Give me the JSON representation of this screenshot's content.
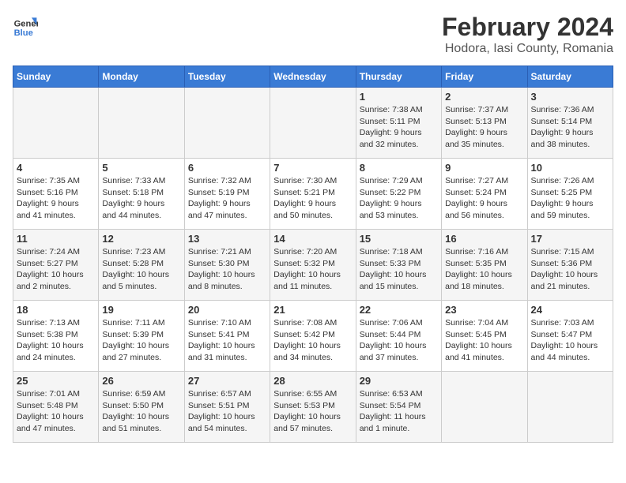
{
  "header": {
    "logo_general": "General",
    "logo_blue": "Blue",
    "main_title": "February 2024",
    "subtitle": "Hodora, Iasi County, Romania"
  },
  "columns": [
    "Sunday",
    "Monday",
    "Tuesday",
    "Wednesday",
    "Thursday",
    "Friday",
    "Saturday"
  ],
  "weeks": [
    [
      {
        "day": "",
        "info": ""
      },
      {
        "day": "",
        "info": ""
      },
      {
        "day": "",
        "info": ""
      },
      {
        "day": "",
        "info": ""
      },
      {
        "day": "1",
        "info": "Sunrise: 7:38 AM\nSunset: 5:11 PM\nDaylight: 9 hours\nand 32 minutes."
      },
      {
        "day": "2",
        "info": "Sunrise: 7:37 AM\nSunset: 5:13 PM\nDaylight: 9 hours\nand 35 minutes."
      },
      {
        "day": "3",
        "info": "Sunrise: 7:36 AM\nSunset: 5:14 PM\nDaylight: 9 hours\nand 38 minutes."
      }
    ],
    [
      {
        "day": "4",
        "info": "Sunrise: 7:35 AM\nSunset: 5:16 PM\nDaylight: 9 hours\nand 41 minutes."
      },
      {
        "day": "5",
        "info": "Sunrise: 7:33 AM\nSunset: 5:18 PM\nDaylight: 9 hours\nand 44 minutes."
      },
      {
        "day": "6",
        "info": "Sunrise: 7:32 AM\nSunset: 5:19 PM\nDaylight: 9 hours\nand 47 minutes."
      },
      {
        "day": "7",
        "info": "Sunrise: 7:30 AM\nSunset: 5:21 PM\nDaylight: 9 hours\nand 50 minutes."
      },
      {
        "day": "8",
        "info": "Sunrise: 7:29 AM\nSunset: 5:22 PM\nDaylight: 9 hours\nand 53 minutes."
      },
      {
        "day": "9",
        "info": "Sunrise: 7:27 AM\nSunset: 5:24 PM\nDaylight: 9 hours\nand 56 minutes."
      },
      {
        "day": "10",
        "info": "Sunrise: 7:26 AM\nSunset: 5:25 PM\nDaylight: 9 hours\nand 59 minutes."
      }
    ],
    [
      {
        "day": "11",
        "info": "Sunrise: 7:24 AM\nSunset: 5:27 PM\nDaylight: 10 hours\nand 2 minutes."
      },
      {
        "day": "12",
        "info": "Sunrise: 7:23 AM\nSunset: 5:28 PM\nDaylight: 10 hours\nand 5 minutes."
      },
      {
        "day": "13",
        "info": "Sunrise: 7:21 AM\nSunset: 5:30 PM\nDaylight: 10 hours\nand 8 minutes."
      },
      {
        "day": "14",
        "info": "Sunrise: 7:20 AM\nSunset: 5:32 PM\nDaylight: 10 hours\nand 11 minutes."
      },
      {
        "day": "15",
        "info": "Sunrise: 7:18 AM\nSunset: 5:33 PM\nDaylight: 10 hours\nand 15 minutes."
      },
      {
        "day": "16",
        "info": "Sunrise: 7:16 AM\nSunset: 5:35 PM\nDaylight: 10 hours\nand 18 minutes."
      },
      {
        "day": "17",
        "info": "Sunrise: 7:15 AM\nSunset: 5:36 PM\nDaylight: 10 hours\nand 21 minutes."
      }
    ],
    [
      {
        "day": "18",
        "info": "Sunrise: 7:13 AM\nSunset: 5:38 PM\nDaylight: 10 hours\nand 24 minutes."
      },
      {
        "day": "19",
        "info": "Sunrise: 7:11 AM\nSunset: 5:39 PM\nDaylight: 10 hours\nand 27 minutes."
      },
      {
        "day": "20",
        "info": "Sunrise: 7:10 AM\nSunset: 5:41 PM\nDaylight: 10 hours\nand 31 minutes."
      },
      {
        "day": "21",
        "info": "Sunrise: 7:08 AM\nSunset: 5:42 PM\nDaylight: 10 hours\nand 34 minutes."
      },
      {
        "day": "22",
        "info": "Sunrise: 7:06 AM\nSunset: 5:44 PM\nDaylight: 10 hours\nand 37 minutes."
      },
      {
        "day": "23",
        "info": "Sunrise: 7:04 AM\nSunset: 5:45 PM\nDaylight: 10 hours\nand 41 minutes."
      },
      {
        "day": "24",
        "info": "Sunrise: 7:03 AM\nSunset: 5:47 PM\nDaylight: 10 hours\nand 44 minutes."
      }
    ],
    [
      {
        "day": "25",
        "info": "Sunrise: 7:01 AM\nSunset: 5:48 PM\nDaylight: 10 hours\nand 47 minutes."
      },
      {
        "day": "26",
        "info": "Sunrise: 6:59 AM\nSunset: 5:50 PM\nDaylight: 10 hours\nand 51 minutes."
      },
      {
        "day": "27",
        "info": "Sunrise: 6:57 AM\nSunset: 5:51 PM\nDaylight: 10 hours\nand 54 minutes."
      },
      {
        "day": "28",
        "info": "Sunrise: 6:55 AM\nSunset: 5:53 PM\nDaylight: 10 hours\nand 57 minutes."
      },
      {
        "day": "29",
        "info": "Sunrise: 6:53 AM\nSunset: 5:54 PM\nDaylight: 11 hours\nand 1 minute."
      },
      {
        "day": "",
        "info": ""
      },
      {
        "day": "",
        "info": ""
      }
    ]
  ]
}
